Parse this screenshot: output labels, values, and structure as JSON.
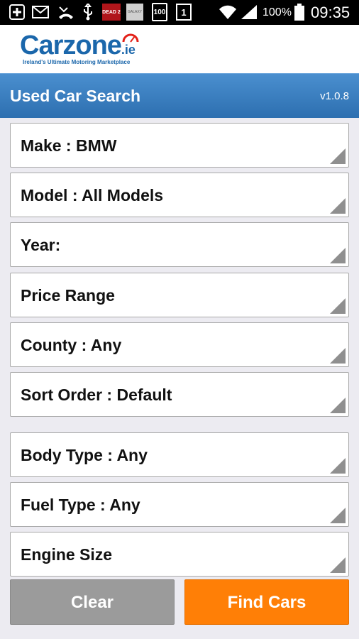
{
  "status_bar": {
    "icons": [
      "add-icon",
      "mail-icon",
      "missed-call-icon",
      "usb-icon",
      "game-app-icon",
      "galaxy-app-icon",
      "storage-icon",
      "sim-one-icon",
      "wifi-icon",
      "signal-icon",
      "battery-icon"
    ],
    "battery": "100%",
    "time": "09:35",
    "game_icon_text": "DEAD 2",
    "galaxy_icon_text": "GALAXY",
    "storage_icon_text": "100",
    "sim_icon_text": "1"
  },
  "logo": {
    "name": "Carzone",
    "suffix": ".ie",
    "tagline": "Ireland's Ultimate Motoring Marketplace"
  },
  "header": {
    "title": "Used Car Search",
    "version": "v1.0.8"
  },
  "fields": {
    "make": "Make : BMW",
    "model": "Model : All Models",
    "year": "Year:",
    "price": "Price Range",
    "county": "County : Any",
    "sort": "Sort Order : Default",
    "body": "Body Type : Any",
    "fuel": "Fuel Type : Any",
    "engine": "Engine Size"
  },
  "buttons": {
    "clear": "Clear",
    "find": "Find Cars"
  },
  "colors": {
    "accent_orange": "#ff7f06",
    "header_blue": "#2d6fb0",
    "clear_gray": "#9b9b9b"
  }
}
